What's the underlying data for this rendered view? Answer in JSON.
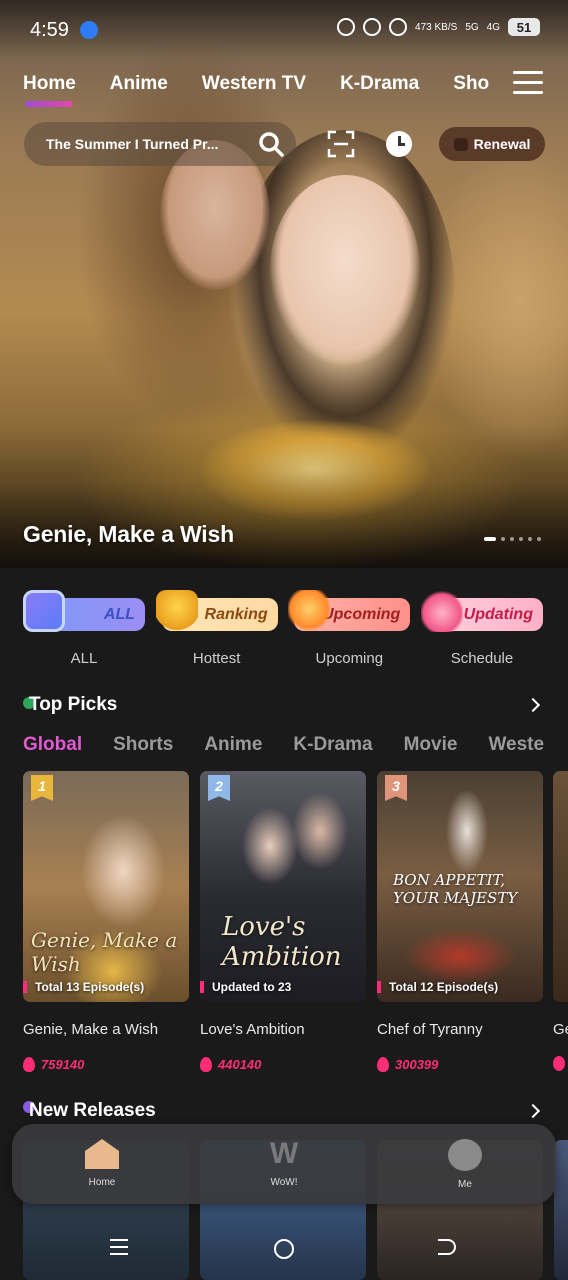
{
  "status_bar": {
    "time": "4:59",
    "net_speed": "473 KB/S",
    "network_1": "5G",
    "network_2": "4G",
    "battery": "51"
  },
  "nav_tabs": [
    "Home",
    "Anime",
    "Western TV",
    "K-Drama",
    "Sho"
  ],
  "search": {
    "placeholder": "The Summer I Turned Pr..."
  },
  "renewal_label": "Renewal",
  "hero": {
    "title": "Genie, Make a Wish",
    "slide_count": 6,
    "active_slide": 1
  },
  "categories": [
    {
      "chip": "ALL",
      "label": "ALL"
    },
    {
      "chip": "Ranking",
      "label": "Hottest"
    },
    {
      "chip": "Upcoming",
      "label": "Upcoming"
    },
    {
      "chip": "Updating",
      "label": "Schedule"
    }
  ],
  "top_picks": {
    "title": "Top Picks",
    "tabs": [
      "Global",
      "Shorts",
      "Anime",
      "K-Drama",
      "Movie",
      "Weste"
    ],
    "items": [
      {
        "rank": "1",
        "poster_title": "Genie, Make a Wish",
        "tag": "Total 13 Episode(s)",
        "name": "Genie, Make a Wish",
        "views": "759140"
      },
      {
        "rank": "2",
        "poster_title": "Love's Ambition",
        "tag": "Updated to 23",
        "name": "Love's Ambition",
        "views": "440140"
      },
      {
        "rank": "3",
        "poster_title": "BON APPETIT, YOUR MAJESTY",
        "tag": "Total 12 Episode(s)",
        "name": "Chef of Tyranny",
        "views": "300399"
      }
    ],
    "peek_name": "Ge"
  },
  "new_releases": {
    "title": "New Releases"
  },
  "bottom_nav": [
    {
      "label": "Home",
      "icon": "home-icon"
    },
    {
      "label": "WoW!",
      "icon": "wow-icon",
      "glyph": "W"
    },
    {
      "label": "Me",
      "icon": "me-icon"
    }
  ],
  "colors": {
    "accent_pink": "#ff2d77",
    "tab_active": "#e25ad2",
    "background": "#1a1a1a"
  }
}
